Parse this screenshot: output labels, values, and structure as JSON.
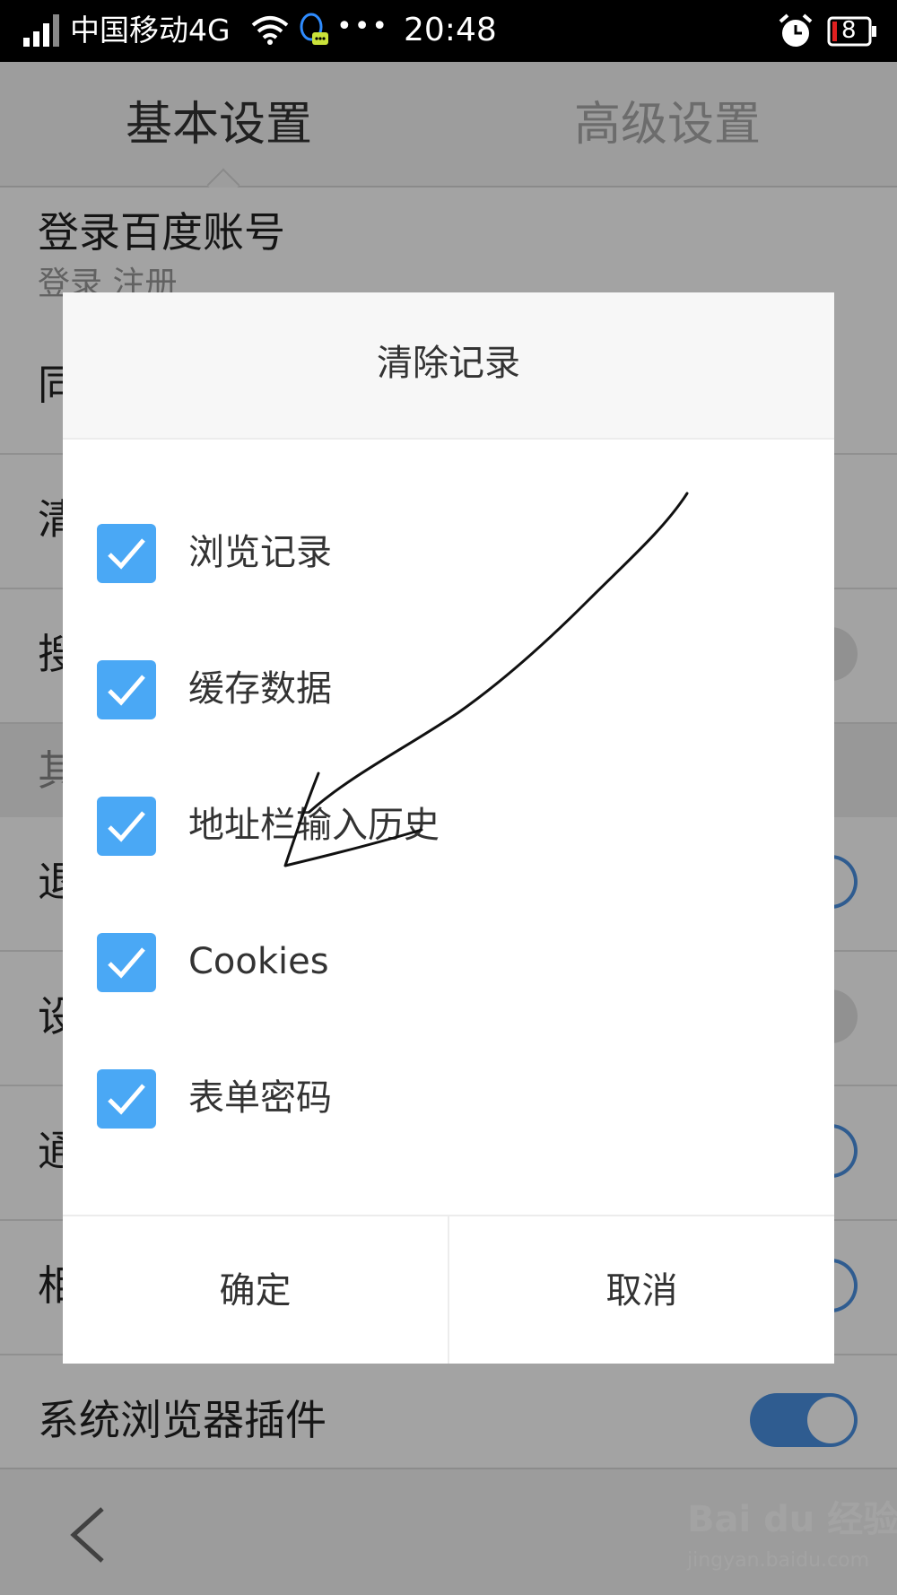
{
  "status_bar": {
    "carrier": "中国移动4G",
    "more": "•••",
    "time": "20:48",
    "battery_level": "8",
    "icons": [
      "signal-icon",
      "wifi-icon",
      "qq-notification-icon",
      "alarm-icon",
      "battery-icon"
    ]
  },
  "settings": {
    "tabs": [
      {
        "label": "基本设置",
        "active": true
      },
      {
        "label": "高级设置",
        "active": false
      }
    ],
    "account": {
      "label": "登录百度账号",
      "sub": "登录 注册"
    },
    "rows_partial": [
      "同",
      "清",
      "搜",
      "其",
      "退",
      "设",
      "通",
      "相"
    ],
    "plugin_row": {
      "label": "系统浏览器插件",
      "toggle_on": true
    }
  },
  "dialog": {
    "title": "清除记录",
    "options": [
      {
        "label": "浏览记录",
        "checked": true
      },
      {
        "label": "缓存数据",
        "checked": true
      },
      {
        "label": "地址栏输入历史",
        "checked": true
      },
      {
        "label": "Cookies",
        "checked": true
      },
      {
        "label": "表单密码",
        "checked": true
      }
    ],
    "confirm_label": "确定",
    "cancel_label": "取消"
  },
  "watermark": {
    "brand": "Bai du 经验",
    "url": "jingyan.baidu.com"
  },
  "colors": {
    "checkbox": "#4aa8f5",
    "toggle_on": "#4a90e2",
    "status_bar": "#000000"
  }
}
